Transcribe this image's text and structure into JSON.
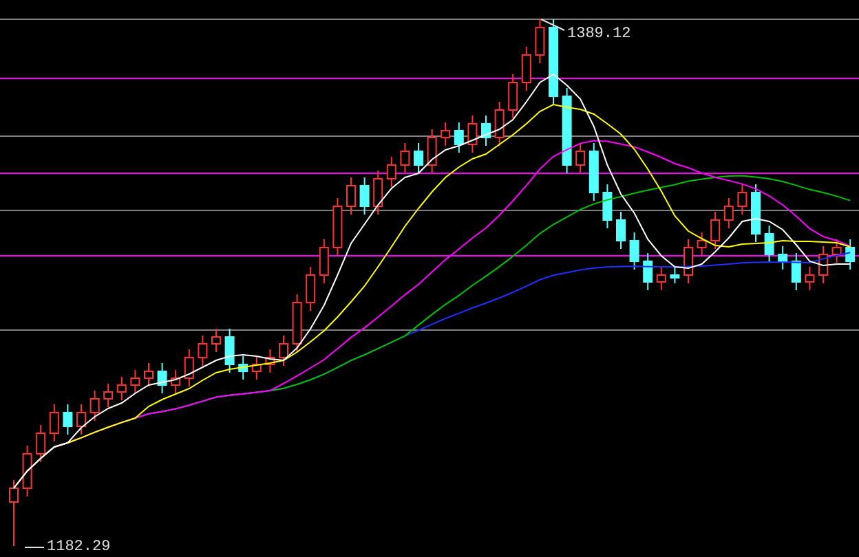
{
  "chart": {
    "high_label": "1389.12",
    "low_label": "1182.29"
  }
}
